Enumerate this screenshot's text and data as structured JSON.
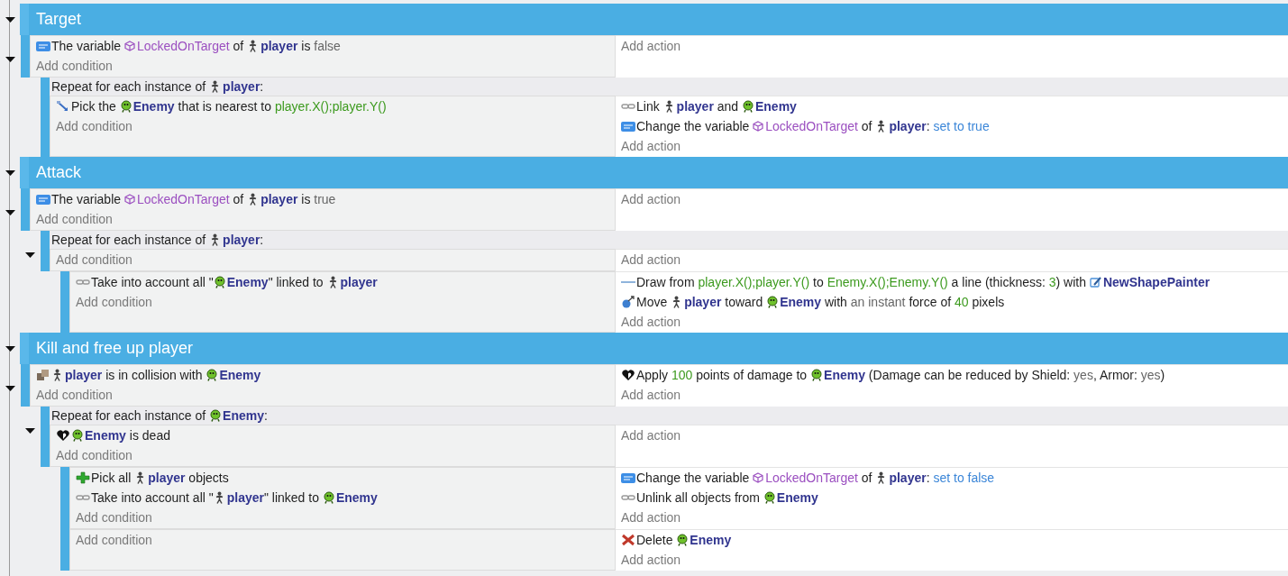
{
  "groups": [
    {
      "title": "Target",
      "expanded": true,
      "events": [
        {
          "kind": "standard",
          "expanded": true,
          "conditions": [
            {
              "kind": "variable",
              "parts": [
                {
                  "kind": "text",
                  "text": "The variable "
                },
                {
                  "kind": "variable",
                  "text": "LockedOnTarget"
                },
                {
                  "kind": "text",
                  "text": " of "
                },
                {
                  "kind": "player",
                  "text": "player"
                },
                {
                  "kind": "text",
                  "text": " is "
                },
                {
                  "kind": "value",
                  "text": "false"
                }
              ]
            }
          ],
          "add_condition": "Add condition",
          "add_action": "Add action",
          "children": [
            {
              "kind": "foreach",
              "header": [
                {
                  "kind": "text",
                  "text": "Repeat for each instance of "
                },
                {
                  "kind": "player",
                  "text": "player"
                },
                {
                  "kind": "text",
                  "text": ":"
                }
              ],
              "conditions": [
                {
                  "kind": "nearest",
                  "parts": [
                    {
                      "kind": "text",
                      "text": "Pick the "
                    },
                    {
                      "kind": "enemy",
                      "text": "Enemy"
                    },
                    {
                      "kind": "text",
                      "text": " that is nearest to "
                    },
                    {
                      "kind": "number",
                      "text": "player.X();player.Y()"
                    }
                  ]
                }
              ],
              "add_condition": "Add condition",
              "actions": [
                {
                  "kind": "link",
                  "parts": [
                    {
                      "kind": "text",
                      "text": "Link "
                    },
                    {
                      "kind": "player",
                      "text": "player"
                    },
                    {
                      "kind": "text",
                      "text": " and "
                    },
                    {
                      "kind": "enemy",
                      "text": "Enemy"
                    }
                  ]
                },
                {
                  "kind": "variable",
                  "parts": [
                    {
                      "kind": "text",
                      "text": "Change the variable "
                    },
                    {
                      "kind": "variable",
                      "text": "LockedOnTarget"
                    },
                    {
                      "kind": "text",
                      "text": " of "
                    },
                    {
                      "kind": "player",
                      "text": "player"
                    },
                    {
                      "kind": "text",
                      "text": ": "
                    },
                    {
                      "kind": "link",
                      "text": "set to true"
                    }
                  ]
                }
              ],
              "add_action": "Add action"
            }
          ]
        }
      ]
    },
    {
      "title": "Attack",
      "expanded": true,
      "events": [
        {
          "kind": "standard",
          "expanded": true,
          "conditions": [
            {
              "kind": "variable",
              "parts": [
                {
                  "kind": "text",
                  "text": "The variable "
                },
                {
                  "kind": "variable",
                  "text": "LockedOnTarget"
                },
                {
                  "kind": "text",
                  "text": " of "
                },
                {
                  "kind": "player",
                  "text": "player"
                },
                {
                  "kind": "text",
                  "text": " is "
                },
                {
                  "kind": "value",
                  "text": "true"
                }
              ]
            }
          ],
          "add_condition": "Add condition",
          "add_action": "Add action",
          "children": [
            {
              "kind": "foreach",
              "expanded": true,
              "header": [
                {
                  "kind": "text",
                  "text": "Repeat for each instance of "
                },
                {
                  "kind": "player",
                  "text": "player"
                },
                {
                  "kind": "text",
                  "text": ":"
                }
              ],
              "add_condition": "Add condition",
              "add_action": "Add action",
              "children": [
                {
                  "kind": "standard",
                  "conditions": [
                    {
                      "kind": "link",
                      "parts": [
                        {
                          "kind": "text",
                          "text": "Take into account all \""
                        },
                        {
                          "kind": "enemy",
                          "text": "Enemy"
                        },
                        {
                          "kind": "text",
                          "text": "\" linked to "
                        },
                        {
                          "kind": "player",
                          "text": "player"
                        }
                      ]
                    }
                  ],
                  "add_condition": "Add condition",
                  "actions": [
                    {
                      "kind": "line",
                      "parts": [
                        {
                          "kind": "text",
                          "text": "Draw from "
                        },
                        {
                          "kind": "number",
                          "text": "player.X();player.Y()"
                        },
                        {
                          "kind": "text",
                          "text": " to "
                        },
                        {
                          "kind": "number",
                          "text": "Enemy.X();Enemy.Y()"
                        },
                        {
                          "kind": "text",
                          "text": " a line (thickness: "
                        },
                        {
                          "kind": "number",
                          "text": "3"
                        },
                        {
                          "kind": "text",
                          "text": ") with "
                        },
                        {
                          "kind": "painter",
                          "text": "NewShapePainter"
                        }
                      ]
                    },
                    {
                      "kind": "force",
                      "parts": [
                        {
                          "kind": "text",
                          "text": "Move "
                        },
                        {
                          "kind": "player",
                          "text": "player"
                        },
                        {
                          "kind": "text",
                          "text": " toward "
                        },
                        {
                          "kind": "enemy",
                          "text": "Enemy"
                        },
                        {
                          "kind": "text",
                          "text": " with "
                        },
                        {
                          "kind": "value",
                          "text": "an instant"
                        },
                        {
                          "kind": "text",
                          "text": " force of "
                        },
                        {
                          "kind": "number",
                          "text": "40"
                        },
                        {
                          "kind": "text",
                          "text": " pixels"
                        }
                      ]
                    }
                  ],
                  "add_action": "Add action"
                }
              ]
            }
          ]
        }
      ]
    },
    {
      "title": "Kill and free up player",
      "expanded": true,
      "events": [
        {
          "kind": "standard",
          "expanded": true,
          "conditions": [
            {
              "kind": "collision",
              "parts": [
                {
                  "kind": "player",
                  "text": "player"
                },
                {
                  "kind": "text",
                  "text": " is in collision with "
                },
                {
                  "kind": "enemy",
                  "text": "Enemy"
                }
              ]
            }
          ],
          "add_condition": "Add condition",
          "actions": [
            {
              "kind": "health",
              "parts": [
                {
                  "kind": "text",
                  "text": "Apply "
                },
                {
                  "kind": "number",
                  "text": "100"
                },
                {
                  "kind": "text",
                  "text": " points of damage to "
                },
                {
                  "kind": "enemy",
                  "text": "Enemy"
                },
                {
                  "kind": "text",
                  "text": " (Damage can be reduced by Shield: "
                },
                {
                  "kind": "value",
                  "text": "yes"
                },
                {
                  "kind": "text",
                  "text": ", Armor: "
                },
                {
                  "kind": "value",
                  "text": "yes"
                },
                {
                  "kind": "text",
                  "text": ")"
                }
              ]
            }
          ],
          "add_action": "Add action",
          "children": [
            {
              "kind": "foreach",
              "expanded": true,
              "header": [
                {
                  "kind": "text",
                  "text": "Repeat for each instance of "
                },
                {
                  "kind": "enemy",
                  "text": "Enemy"
                },
                {
                  "kind": "text",
                  "text": ":"
                }
              ],
              "conditions": [
                {
                  "kind": "health",
                  "parts": [
                    {
                      "kind": "enemy",
                      "text": "Enemy"
                    },
                    {
                      "kind": "text",
                      "text": " is dead"
                    }
                  ]
                }
              ],
              "add_condition": "Add condition",
              "add_action": "Add action",
              "children": [
                {
                  "kind": "standard",
                  "conditions": [
                    {
                      "kind": "pickall",
                      "parts": [
                        {
                          "kind": "text",
                          "text": "Pick all "
                        },
                        {
                          "kind": "player",
                          "text": "player"
                        },
                        {
                          "kind": "text",
                          "text": " objects"
                        }
                      ]
                    },
                    {
                      "kind": "link",
                      "parts": [
                        {
                          "kind": "text",
                          "text": "Take into account all \""
                        },
                        {
                          "kind": "player",
                          "text": "player"
                        },
                        {
                          "kind": "text",
                          "text": "\" linked to "
                        },
                        {
                          "kind": "enemy",
                          "text": "Enemy"
                        }
                      ]
                    }
                  ],
                  "add_condition": "Add condition",
                  "actions": [
                    {
                      "kind": "variable",
                      "parts": [
                        {
                          "kind": "text",
                          "text": "Change the variable "
                        },
                        {
                          "kind": "variable",
                          "text": "LockedOnTarget"
                        },
                        {
                          "kind": "text",
                          "text": " of "
                        },
                        {
                          "kind": "player",
                          "text": "player"
                        },
                        {
                          "kind": "text",
                          "text": ": "
                        },
                        {
                          "kind": "link",
                          "text": "set to false"
                        }
                      ]
                    },
                    {
                      "kind": "link",
                      "parts": [
                        {
                          "kind": "text",
                          "text": "Unlink all objects from "
                        },
                        {
                          "kind": "enemy",
                          "text": "Enemy"
                        }
                      ]
                    }
                  ],
                  "add_action": "Add action"
                },
                {
                  "kind": "standard",
                  "add_condition": "Add condition",
                  "actions": [
                    {
                      "kind": "delete",
                      "parts": [
                        {
                          "kind": "text",
                          "text": "Delete "
                        },
                        {
                          "kind": "enemy",
                          "text": "Enemy"
                        }
                      ]
                    }
                  ],
                  "add_action": "Add action"
                }
              ]
            }
          ]
        }
      ]
    }
  ]
}
